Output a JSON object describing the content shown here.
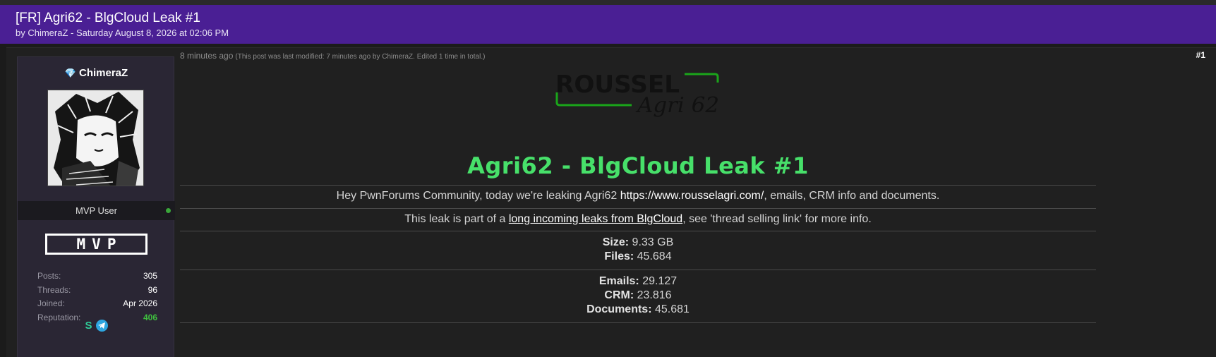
{
  "thread": {
    "title": "[FR] Agri62 - BlgCloud Leak #1",
    "byline": "by ChimeraZ - Saturday August 8, 2026 at 02:06 PM"
  },
  "user": {
    "name": "ChimeraZ",
    "rank": "MVP User",
    "badge": "MVP",
    "stats": [
      {
        "label": "Posts:",
        "value": "305"
      },
      {
        "label": "Threads:",
        "value": "96"
      },
      {
        "label": "Joined:",
        "value": "Apr 2026"
      },
      {
        "label": "Reputation:",
        "value": "406"
      }
    ],
    "social_s": "S",
    "icons": [
      "diamond-icon",
      "online-dot",
      "session-icon",
      "telegram-icon"
    ]
  },
  "post": {
    "time": "8 minutes ago",
    "modified_note": "(This post was last modified: 7 minutes ago by ChimeraZ. Edited 1 time in total.)",
    "number": "#1",
    "logo": {
      "top": "ROUSSEL",
      "bottom": "Agri 62"
    },
    "heading": "Agri62 - BlgCloud Leak #1",
    "intro_pre": "Hey PwnForums Community, today we're leaking Agri62 ",
    "intro_link": "https://www.rousselagri.com/",
    "intro_post": ", emails, CRM info and documents.",
    "part_pre": "This leak is part of a ",
    "part_link": "long incoming leaks from BlgCloud",
    "part_post": ", see 'thread selling link' for more info.",
    "size_label": "Size:",
    "size_value": " 9.33 GB",
    "files_label": "Files:",
    "files_value": " 45.684",
    "emails_label": "Emails:",
    "emails_value": " 29.127",
    "crm_label": "CRM:",
    "crm_value": " 23.816",
    "docs_label": "Documents:",
    "docs_value": " 45.681"
  },
  "colors": {
    "header_bg": "#4a1f94",
    "heading_green": "#47e06a",
    "reputation_green": "#3fbf3f",
    "logo_green": "#1aa51a"
  }
}
